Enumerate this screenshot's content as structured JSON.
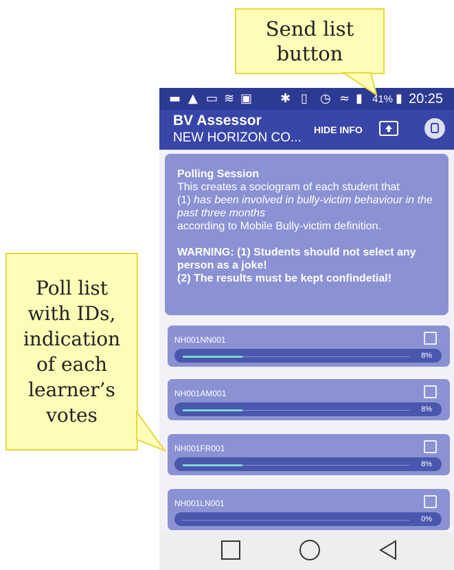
{
  "callouts": {
    "send": "Send list\nbutton",
    "poll": "Poll list\nwith IDs,\nindication\nof each\nlearner’s\nvotes"
  },
  "status_bar": {
    "battery": "41%",
    "time": "20:25",
    "icons": [
      "message-icon",
      "app-notification-icon",
      "cast-icon",
      "wifi-direct-icon",
      "image-icon",
      "bluetooth-icon",
      "vibrate-icon",
      "alarm-icon",
      "wifi-icon",
      "signal-icon",
      "battery-icon"
    ]
  },
  "app_bar": {
    "title": "BV Assessor",
    "subtitle": "NEW HORIZON CO...",
    "hide_info": "HIDE INFO",
    "send_icon": "send-list-icon",
    "db_icon": "database-icon"
  },
  "info": {
    "title": "Polling Session",
    "line1": "This creates a sociogram of each student that",
    "line2_prefix": "(1) ",
    "line2_italic": "has been involved in bully-victim behaviour in the past three months",
    "line3": "according to Mobile Bully-victim definition.",
    "warning1": "WARNING: (1) Students should not select any person as a joke!",
    "warning2": "(2) The results must be kept confindetial!"
  },
  "poll_items": [
    {
      "id": "NH001NN001",
      "percent": "8%",
      "progress": 0.08
    },
    {
      "id": "NH001AM001",
      "percent": "8%",
      "progress": 0.08
    },
    {
      "id": "NH001FR001",
      "percent": "8%",
      "progress": 0.08
    },
    {
      "id": "NH001LN001",
      "percent": "0%",
      "progress": 0.0
    }
  ],
  "colors": {
    "status_bar": "#2d3a94",
    "app_bar": "#3846a8",
    "card": "#8a92d4",
    "progress_fill": "#7fd4d0",
    "callout_bg": "#fdfdb8"
  }
}
